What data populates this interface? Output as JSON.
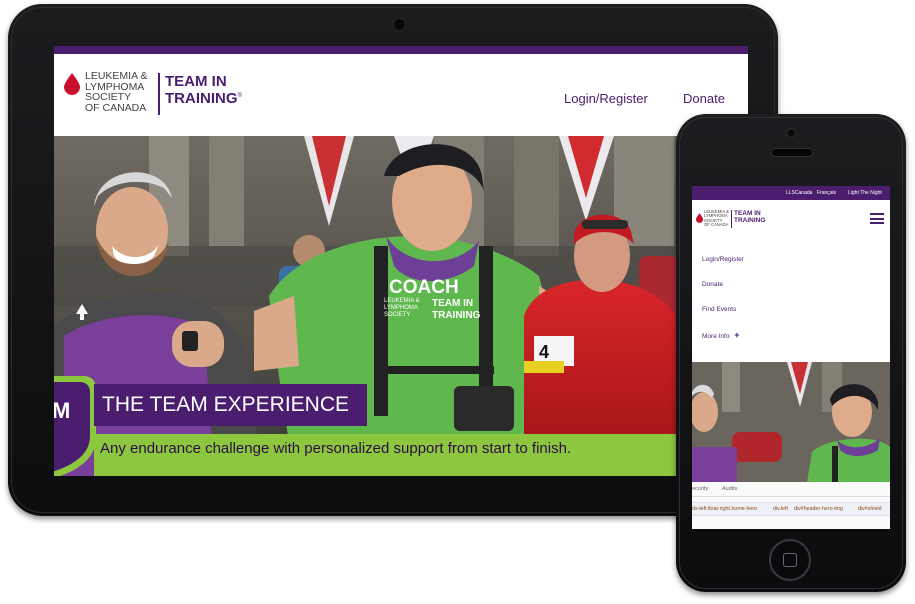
{
  "colors": {
    "brand_purple": "#4b1d6f",
    "accent_green": "#8dc63f",
    "drop_red": "#c8102e"
  },
  "tablet": {
    "logo": {
      "lls_lines": [
        "LEUKEMIA &",
        "LYMPHOMA",
        "SOCIETY",
        "OF CANADA"
      ],
      "tit_lines": [
        "TEAM IN",
        "TRAINING"
      ],
      "tit_mark": "®"
    },
    "nav": {
      "login": "Login/Register",
      "donate": "Donate"
    },
    "hero": {
      "title": "THE TEAM EXPERIENCE",
      "subtitle": "Any endurance challenge with personalized support from start to finish.",
      "shirt_coach": "COACH",
      "shirt_lls_lines": [
        "LEUKEMIA &",
        "LYMPHOMA",
        "SOCIETY"
      ],
      "shirt_tit_lines": [
        "TEAM IN",
        "TRAINING"
      ],
      "bib_number": "4",
      "shield_text": "M"
    }
  },
  "phone": {
    "topbar": {
      "llscanada": "LLSCanada",
      "francais": "Français",
      "light": "Light The Night"
    },
    "logo": {
      "lls_lines": [
        "LEUKEMIA &",
        "LYMPHOMA",
        "SOCIETY",
        "OF CANADA"
      ],
      "tit_lines": [
        "TEAM IN",
        "TRAINING"
      ]
    },
    "menu": {
      "login": "Login/Register",
      "donate": "Donate",
      "find": "Find Events",
      "more": "More Info",
      "more_icon": "+"
    },
    "devtools": {
      "tabs": [
        "ecurity",
        "Audits"
      ],
      "crumbs": [
        "ds-left.float-right.home-hero",
        "div.left",
        "div#header-hero-img",
        "div#shield"
      ]
    }
  }
}
